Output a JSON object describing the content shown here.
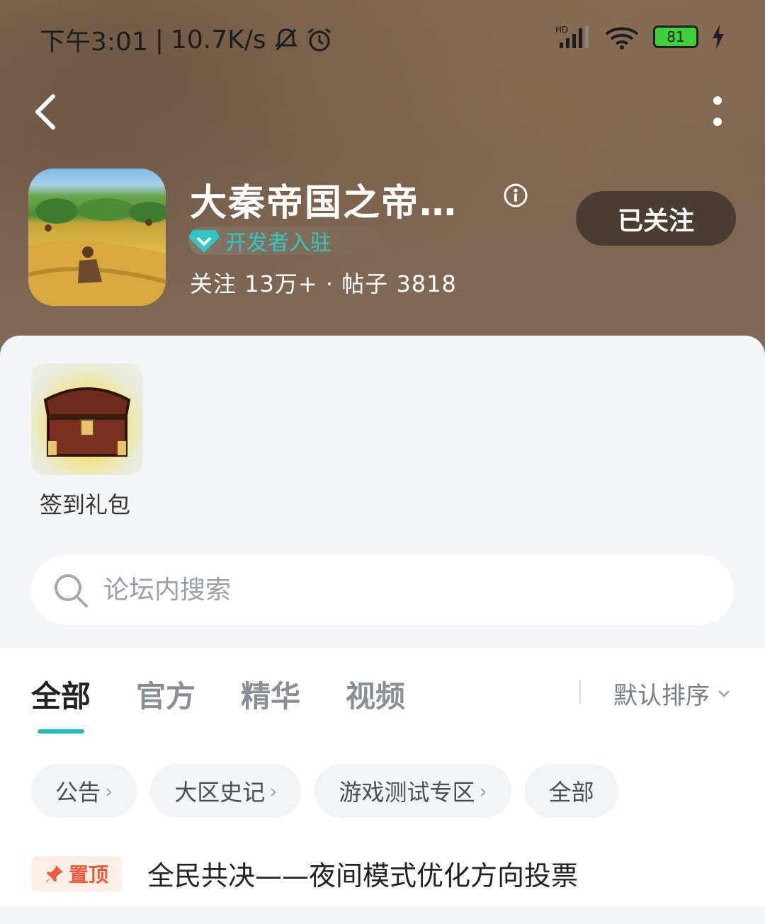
{
  "status_bar": {
    "time": "下午3:01",
    "speed": "10.7K/s",
    "network": "HD",
    "battery": "81"
  },
  "header": {
    "title": "大秦帝国之帝…",
    "badge": "开发者入驻",
    "followers_label": "关注",
    "followers": "13万+",
    "dot": "·",
    "posts_label": "帖子",
    "posts": "3818",
    "follow_button": "已关注",
    "bg_color": "#806a57",
    "button_color": "#4a3d34"
  },
  "gift": {
    "label": "签到礼包"
  },
  "search": {
    "placeholder": "论坛内搜索"
  },
  "tabs": [
    {
      "label": "全部",
      "active": true
    },
    {
      "label": "官方"
    },
    {
      "label": "精华"
    },
    {
      "label": "视频"
    }
  ],
  "sort": {
    "label": "默认排序"
  },
  "chips": [
    {
      "label": "公告",
      "arrow": "›"
    },
    {
      "label": "大区史记",
      "arrow": "›"
    },
    {
      "label": "游戏测试专区",
      "arrow": "›"
    },
    {
      "label": "全部",
      "arrow": ""
    }
  ],
  "pinned": {
    "tag": "置顶",
    "title": "全民共决——夜间模式优化方向投票"
  },
  "colors": {
    "accent": "#27b9b4",
    "pin": "#ee5a3c",
    "badge": "#32c8c3"
  }
}
